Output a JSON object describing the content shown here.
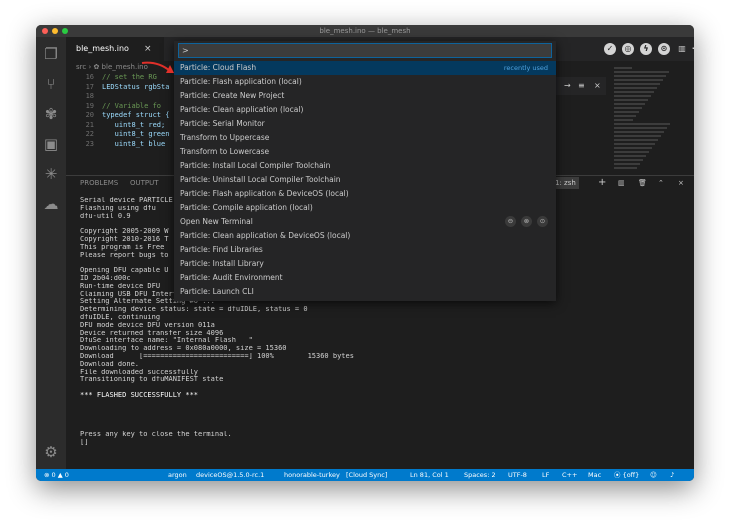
{
  "window": {
    "title": "ble_mesh.ino — ble_mesh",
    "traffic_colors": [
      "#fd5f57",
      "#febc2e",
      "#2acb42"
    ]
  },
  "tab": {
    "label": "ble_mesh.ino",
    "close": "×"
  },
  "breadcrumb": "src › ✿ ble_mesh.ino",
  "editor_lines": [
    {
      "n": "16",
      "t": "// set the RG"
    },
    {
      "n": "17",
      "t": "LEDStatus rgbSta"
    },
    {
      "n": "18",
      "t": ""
    },
    {
      "n": "19",
      "t": "// Variable fo"
    },
    {
      "n": "20",
      "t": "typedef struct {"
    },
    {
      "n": "21",
      "t": "   uint8_t red;"
    },
    {
      "n": "22",
      "t": "   uint8_t green"
    },
    {
      "n": "23",
      "t": "   uint8_t blue"
    }
  ],
  "panel": {
    "problems": "PROBLEMS",
    "output": "OUTPUT",
    "dropdown": "1: zsh"
  },
  "terminal_lines": [
    "Serial device PARTICLE",
    "Flashing using dfu",
    "dfu-util 0.9",
    "",
    "Copyright 2005-2009 W",
    "Copyright 2010-2016 T",
    "This program is Free",
    "Please report bugs to",
    "",
    "Opening DFU capable U",
    "ID 2b04:d00c",
    "Run-time device DFU",
    "Claiming USB DFU Interface...",
    "Setting Alternate Setting #0 ...",
    "Determining device status: state = dfuIDLE, status = 0",
    "dfuIDLE, continuing",
    "DFU mode device DFU version 011a",
    "Device returned transfer size 4096",
    "DfuSe interface name: \"Internal Flash   \"",
    "Downloading to address = 0x080a0000, size = 15360",
    "Download      [=========================] 100%        15360 bytes",
    "Download done.",
    "File downloaded successfully",
    "Transitioning to dfuMANIFEST state",
    "",
    "*** FLASHED SUCCESSFULLY ***",
    "",
    "",
    "",
    "",
    "Press any key to close the terminal.",
    "[]"
  ],
  "command_palette": {
    "input_value": ">",
    "items": [
      {
        "label": "Particle: Cloud Flash",
        "hint": "recently used"
      },
      {
        "label": "Particle: Flash application (local)"
      },
      {
        "label": "Particle: Create New Project"
      },
      {
        "label": "Particle: Clean application (local)"
      },
      {
        "label": "Particle: Serial Monitor"
      },
      {
        "label": "Transform to Uppercase"
      },
      {
        "label": "Transform to Lowercase"
      },
      {
        "label": "Particle: Install Local Compiler Toolchain"
      },
      {
        "label": "Particle: Uninstall Local Compiler Toolchain"
      },
      {
        "label": "Particle: Flash application & DeviceOS (local)"
      },
      {
        "label": "Particle: Compile application (local)"
      },
      {
        "label": "Open New Terminal"
      },
      {
        "label": "Particle: Clean application & DeviceOS (local)"
      },
      {
        "label": "Particle: Find Libraries"
      },
      {
        "label": "Particle: Install Library"
      },
      {
        "label": "Particle: Audit Environment"
      },
      {
        "label": "Particle: Launch CLI"
      }
    ]
  },
  "status": {
    "errors": "⊗ 0 ▲ 0",
    "user": "argon",
    "deviceos": "deviceOS@1.5.0-rc.1",
    "device": "honorable-turkey",
    "mode": "[Cloud Sync]",
    "position": "Ln 81, Col 1",
    "spaces": "Spaces: 2",
    "encoding": "UTF-8",
    "eol": "LF",
    "language": "C++",
    "os": "Mac",
    "live": "⦿ {off}"
  }
}
